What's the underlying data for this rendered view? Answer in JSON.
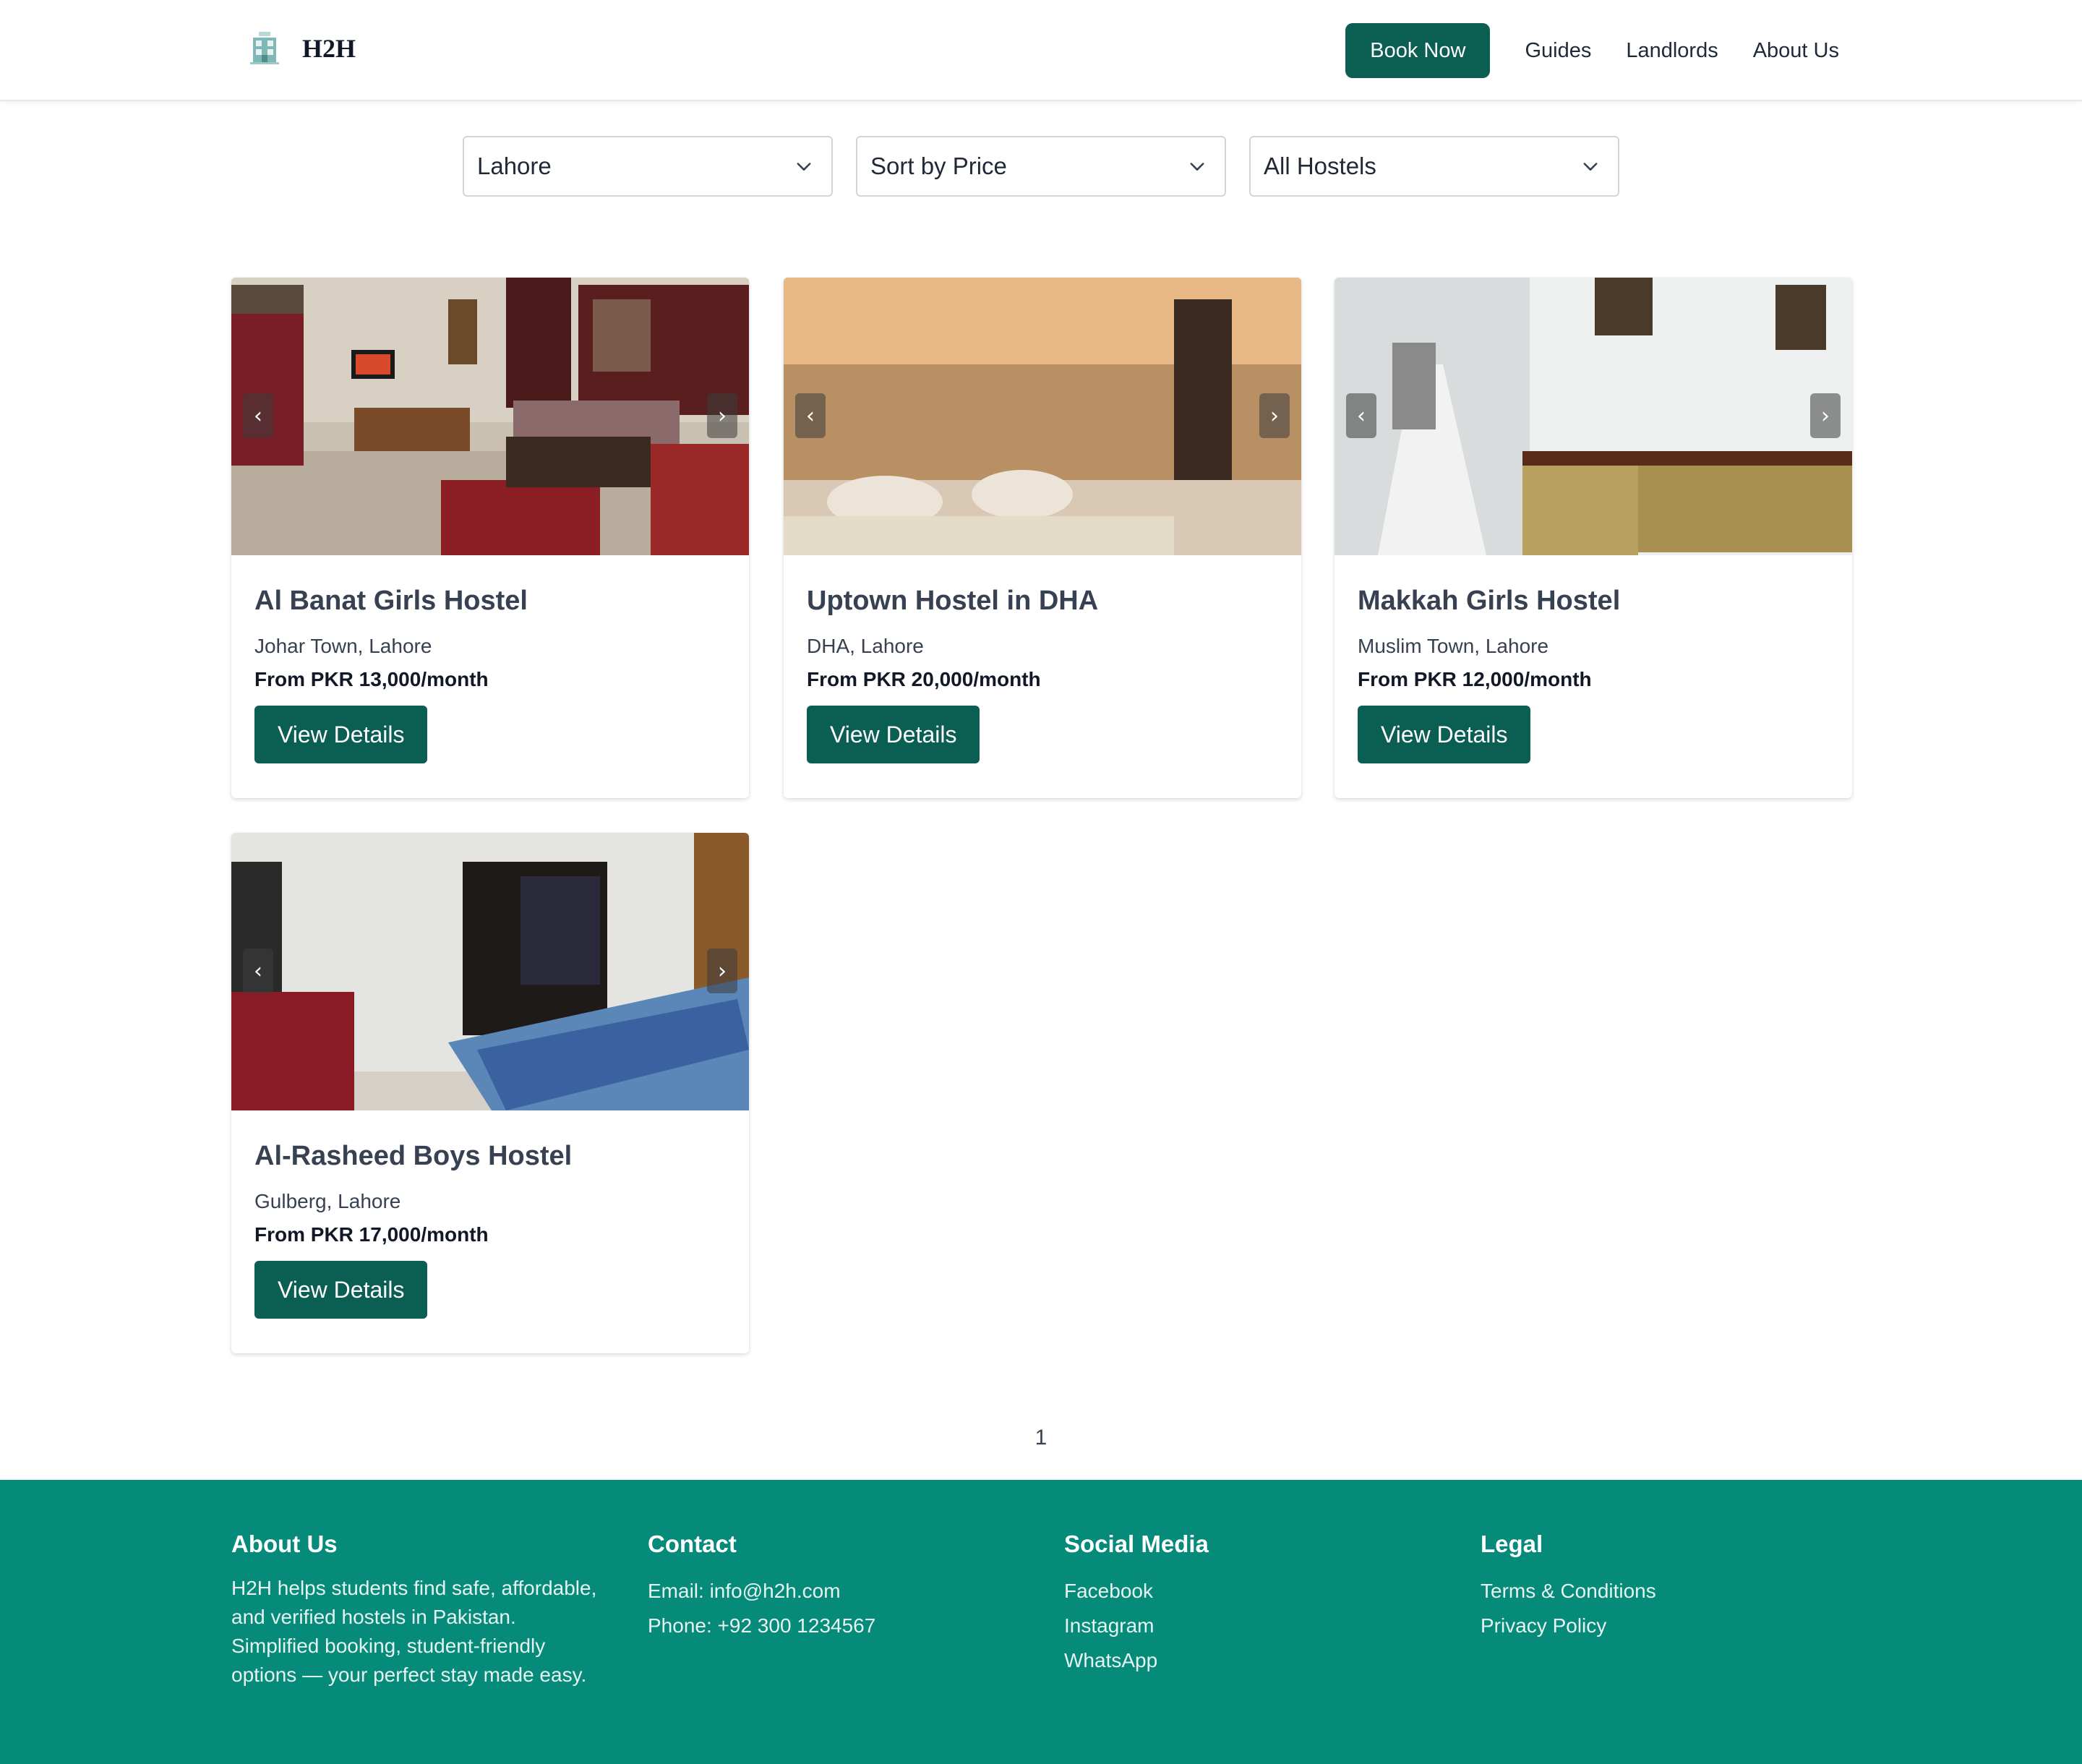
{
  "brand": {
    "name": "H2H"
  },
  "nav": {
    "book_now": "Book Now",
    "links": [
      "Guides",
      "Landlords",
      "About Us"
    ]
  },
  "filters": {
    "city": "Lahore",
    "sort": "Sort by Price",
    "type": "All Hostels"
  },
  "hostels": [
    {
      "name": "Al Banat Girls Hostel",
      "location": "Johar Town, Lahore",
      "price": "From PKR 13,000/month",
      "button": "View Details"
    },
    {
      "name": "Uptown Hostel in DHA",
      "location": "DHA, Lahore",
      "price": "From PKR 20,000/month",
      "button": "View Details"
    },
    {
      "name": "Makkah Girls Hostel",
      "location": "Muslim Town, Lahore",
      "price": "From PKR 12,000/month",
      "button": "View Details"
    },
    {
      "name": "Al-Rasheed Boys Hostel",
      "location": "Gulberg, Lahore",
      "price": "From PKR 17,000/month",
      "button": "View Details"
    }
  ],
  "carousel": {
    "prev": "‹",
    "next": "›"
  },
  "pagination": {
    "current": "1"
  },
  "footer": {
    "about": {
      "title": "About Us",
      "text": "H2H helps students find safe, affordable, and verified hostels in Pakistan. Simplified booking, student-friendly options — your perfect stay made easy."
    },
    "contact": {
      "title": "Contact",
      "email": "Email: info@h2h.com",
      "phone": "Phone: +92 300 1234567"
    },
    "social": {
      "title": "Social Media",
      "links": [
        "Facebook",
        "Instagram",
        "WhatsApp"
      ]
    },
    "legal": {
      "title": "Legal",
      "links": [
        "Terms & Conditions",
        "Privacy Policy"
      ]
    }
  },
  "colors": {
    "primary": "#0b5e52",
    "footer_bg": "#068a7a"
  }
}
